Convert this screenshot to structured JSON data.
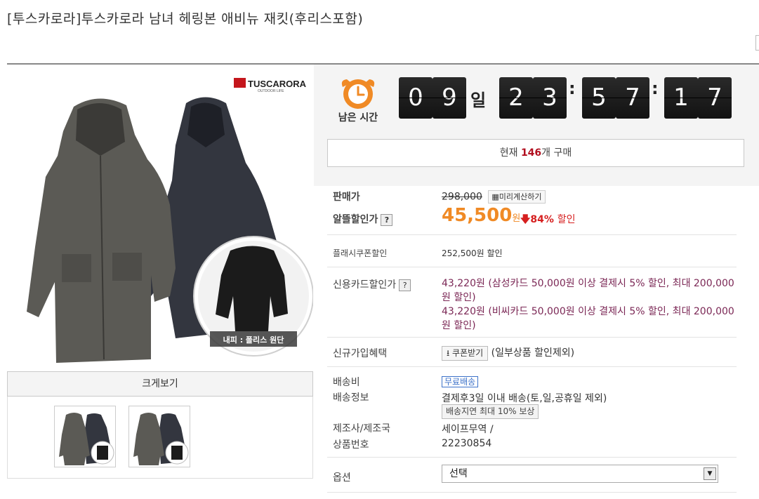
{
  "title": "[투스카로라]투스카로라 남녀 헤링본 애비뉴 재킷(후리스포함)",
  "product_image": {
    "brand_logo": "TUSCARORA",
    "brand_sub": "OUTDOOR LIFE",
    "inset_caption": "내피 : 폴리스 원단",
    "zoom_label": "크게보기",
    "icon": "jacket-image"
  },
  "timer": {
    "label": "남은 시간",
    "icon": "alarm-clock-icon",
    "days": [
      "0",
      "9"
    ],
    "day_unit": "일",
    "hours": [
      "2",
      "3"
    ],
    "minutes": [
      "5",
      "7"
    ],
    "seconds": [
      "1",
      "7"
    ],
    "separator": ":"
  },
  "purchase": {
    "prefix": "현재",
    "count": "146",
    "suffix": "개 구매"
  },
  "price": {
    "sale_label": "판매가",
    "original": "298,000",
    "calc_button": "미리계산하기",
    "discount_label": "알뜰할인가",
    "help_mark": "?",
    "final": "45,500",
    "won": "원",
    "percent": "84%",
    "discount_word": "할인"
  },
  "flash_coupon": {
    "label": "플래시쿠폰할인",
    "value": "252,500원 할인"
  },
  "card": {
    "label": "신용카드할인가",
    "help_mark": "?",
    "lines": [
      "43,220원 (삼성카드 50,000원 이상 결제시 5% 할인, 최대 200,000원 할인)",
      "43,220원 (비씨카드 50,000원 이상 결제시 5% 할인, 최대 200,000원 할인)"
    ]
  },
  "signup": {
    "label": "신규가입혜택",
    "coupon_button": "쿠폰받기",
    "note": "(일부상품 할인제외)"
  },
  "shipping": {
    "fee_label": "배송비",
    "free_badge": "무료배송",
    "info_label": "배송정보",
    "info_value": "결제후3일 이내 배송(토,일,공휴일 제외)",
    "delay_button": "배송지연 최대 10% 보상"
  },
  "maker": {
    "label": "제조사/제조국",
    "value": "세이프무역 /",
    "product_no_label": "상품번호",
    "product_no": "22230854"
  },
  "option": {
    "label": "옵션",
    "selected": "선택"
  },
  "colors": {
    "accent_orange": "#f08a25",
    "discount_red": "#d61f1f",
    "card_purple": "#7b2755",
    "count_red": "#b10f1f"
  }
}
